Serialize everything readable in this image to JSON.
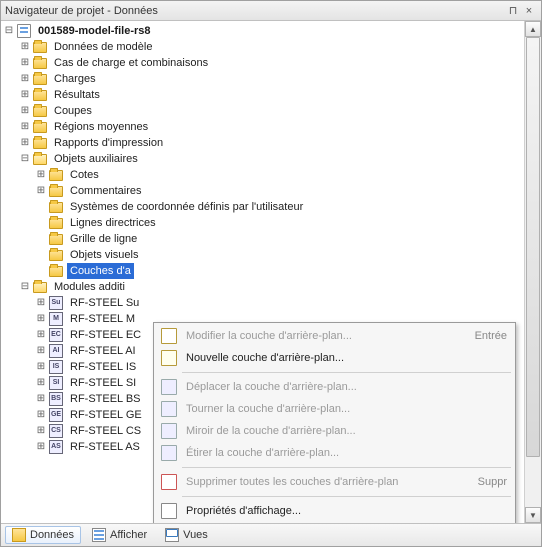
{
  "window": {
    "title": "Navigateur de projet - Données",
    "pin_glyph": "⊓",
    "close_glyph": "×"
  },
  "tree": {
    "root": {
      "label": "001589-model-file-rs8"
    },
    "top": [
      {
        "label": "Données de modèle"
      },
      {
        "label": "Cas de charge et combinaisons"
      },
      {
        "label": "Charges"
      },
      {
        "label": "Résultats"
      },
      {
        "label": "Coupes"
      },
      {
        "label": "Régions moyennes"
      },
      {
        "label": "Rapports d'impression"
      }
    ],
    "aux": {
      "label": "Objets auxiliaires",
      "items": [
        {
          "label": "Cotes",
          "expandable": true
        },
        {
          "label": "Commentaires",
          "expandable": true
        },
        {
          "label": "Systèmes de coordonnée définis par l'utilisateur",
          "expandable": false
        },
        {
          "label": "Lignes directrices",
          "expandable": false
        },
        {
          "label": "Grille de ligne",
          "expandable": false
        },
        {
          "label": "Objets visuels",
          "expandable": false
        },
        {
          "label": "Couches d'a",
          "expandable": false,
          "selected": true
        }
      ]
    },
    "mods": {
      "label": "Modules additi",
      "items": [
        {
          "label": "RF-STEEL Su",
          "tag": "Su"
        },
        {
          "label": "RF-STEEL M",
          "tag": "M"
        },
        {
          "label": "RF-STEEL EC",
          "tag": "EC"
        },
        {
          "label": "RF-STEEL AI",
          "tag": "AI"
        },
        {
          "label": "RF-STEEL IS",
          "tag": "IS"
        },
        {
          "label": "RF-STEEL SI",
          "tag": "SI"
        },
        {
          "label": "RF-STEEL BS",
          "tag": "BS"
        },
        {
          "label": "RF-STEEL GE",
          "tag": "GE"
        },
        {
          "label": "RF-STEEL CS",
          "tag": "CS"
        },
        {
          "label": "RF-STEEL AS",
          "tag": "AS"
        }
      ]
    }
  },
  "context_menu": [
    {
      "kind": "item",
      "label": "Modifier la couche d'arrière-plan...",
      "accel": "Entrée",
      "enabled": false,
      "icon": "edit"
    },
    {
      "kind": "item",
      "label": "Nouvelle couche d'arrière-plan...",
      "accel": "",
      "enabled": true,
      "icon": "new"
    },
    {
      "kind": "sep"
    },
    {
      "kind": "item",
      "label": "Déplacer la couche d'arrière-plan...",
      "accel": "",
      "enabled": false,
      "icon": "move"
    },
    {
      "kind": "item",
      "label": "Tourner la couche d'arrière-plan...",
      "accel": "",
      "enabled": false,
      "icon": "rot"
    },
    {
      "kind": "item",
      "label": "Miroir de la couche d'arrière-plan...",
      "accel": "",
      "enabled": false,
      "icon": "mir"
    },
    {
      "kind": "item",
      "label": "Étirer la couche d'arrière-plan...",
      "accel": "",
      "enabled": false,
      "icon": "str"
    },
    {
      "kind": "sep"
    },
    {
      "kind": "item",
      "label": "Supprimer toutes les couches d'arrière-plan",
      "accel": "Suppr",
      "enabled": false,
      "icon": "del"
    },
    {
      "kind": "sep"
    },
    {
      "kind": "item",
      "label": "Propriétés d'affichage...",
      "accel": "",
      "enabled": true,
      "icon": "prop"
    }
  ],
  "tabs": [
    {
      "label": "Données",
      "active": true,
      "icon": "data"
    },
    {
      "label": "Afficher",
      "active": false,
      "icon": "disp"
    },
    {
      "label": "Vues",
      "active": false,
      "icon": "view"
    }
  ]
}
